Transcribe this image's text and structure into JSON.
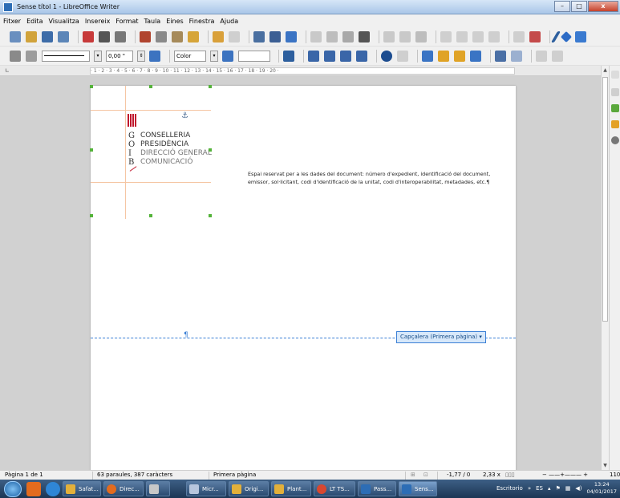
{
  "window": {
    "title": "Sense títol 1 - LibreOffice Writer",
    "min_label": "–",
    "max_label": "□",
    "close_label": "x"
  },
  "menu": [
    "Fitxer",
    "Edita",
    "Visualitza",
    "Insereix",
    "Format",
    "Taula",
    "Eines",
    "Finestra",
    "Ajuda"
  ],
  "toolbar2": {
    "line_width_value": "0,00 \"",
    "area_style_value": "Color"
  },
  "ruler": {
    "marks": "· 1 · 2 · 3 · 4 · 5 · 6 · 7 · 8 · 9 · 10 · 11 · 12 · 13 · 14 · 15 · 16 · 17 · 18 · 19 · 20 ·"
  },
  "document": {
    "logo": {
      "letters": [
        "G",
        "O",
        "I",
        "B"
      ],
      "words": [
        "CONSELLERIA",
        "PRESIDÈNCIA",
        "DIRECCIÓ GENERAL",
        "COMUNICACIÓ"
      ]
    },
    "body_text": "Espai reservat per a les dades del document: número d'expedient, identificació del document, emissor, sol·licitant, codi d'identificació de la unitat, codi d'interoperabilitat, metadades, etc.¶",
    "header_tag": "Capçalera (Primera pàgina) ▾",
    "pilcrow": "¶"
  },
  "status": {
    "page": "Pàgina 1 de 1",
    "words": "63 paraules, 387 caràcters",
    "page_style": "Primera pàgina",
    "position": "-1,77 / 0",
    "size": "2,33 x",
    "zoom": "110"
  },
  "taskbar": {
    "buttons": [
      "Safat...",
      "Direc...",
      "",
      "Micr...",
      "Origi...",
      "Plant...",
      "LT TS...",
      "Pass...",
      "Sens..."
    ],
    "escritorio": "Escritorio",
    "lang": "ES",
    "time": "13:24",
    "date": "04/01/2017"
  }
}
